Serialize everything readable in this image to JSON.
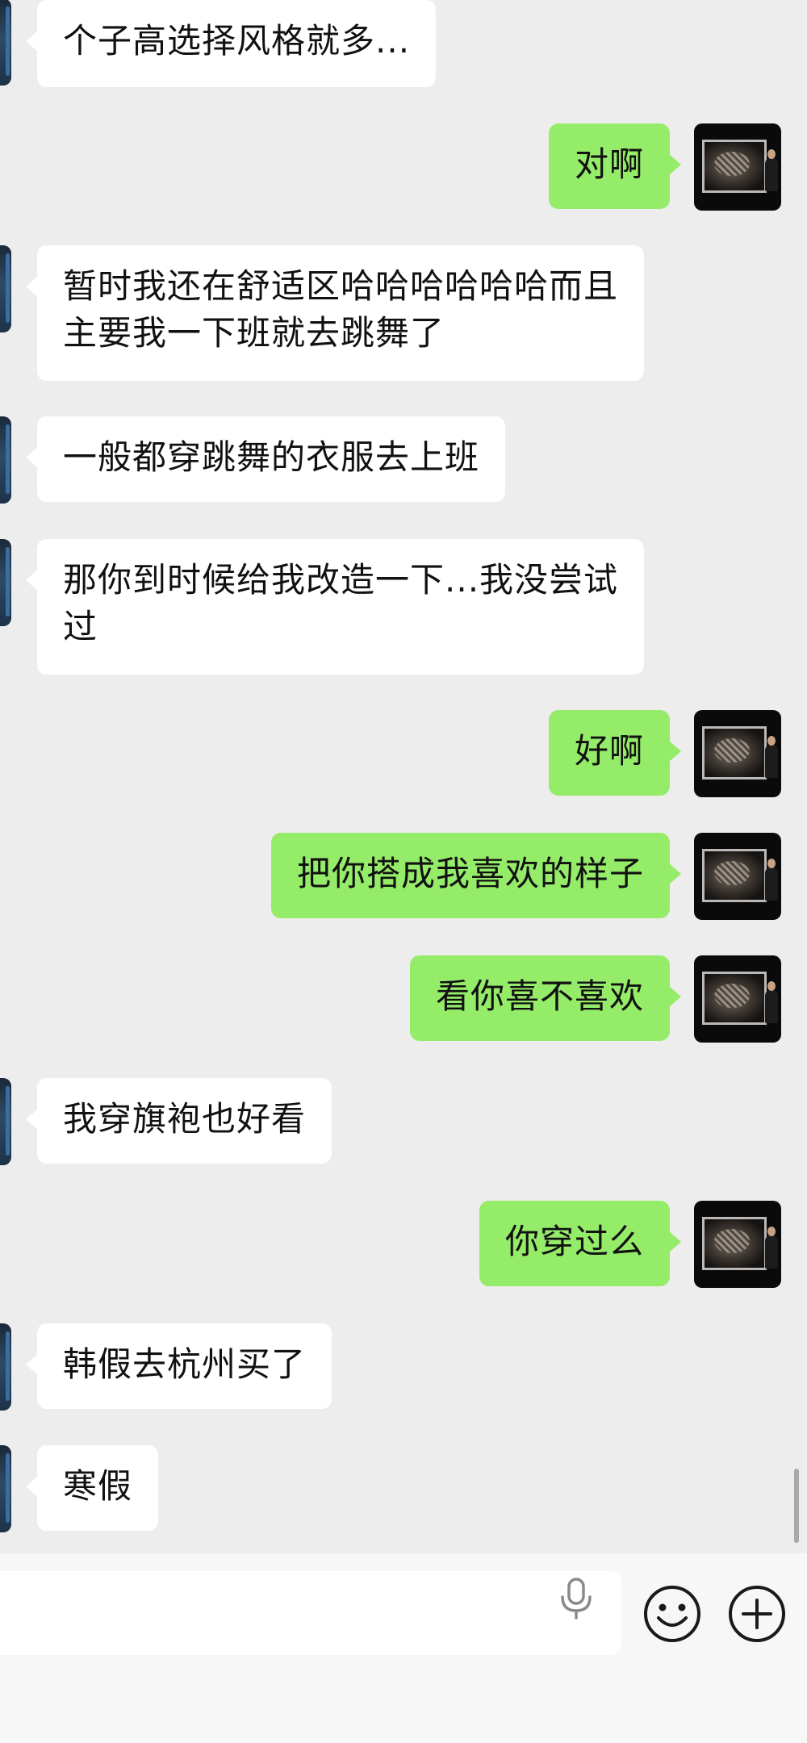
{
  "messages": [
    {
      "side": "in",
      "text": "个子高选择风格就多..."
    },
    {
      "side": "out",
      "text": "对啊"
    },
    {
      "side": "in",
      "text": "暂时我还在舒适区哈哈哈哈哈哈而且\n主要我一下班就去跳舞了"
    },
    {
      "side": "in",
      "text": "一般都穿跳舞的衣服去上班"
    },
    {
      "side": "in",
      "text": "那你到时候给我改造一下...我没尝试\n过"
    },
    {
      "side": "out",
      "text": "好啊"
    },
    {
      "side": "out",
      "text": "把你搭成我喜欢的样子"
    },
    {
      "side": "out",
      "text": "看你喜不喜欢"
    },
    {
      "side": "in",
      "text": "我穿旗袍也好看"
    },
    {
      "side": "out",
      "text": "你穿过么"
    },
    {
      "side": "in",
      "text": "韩假去杭州买了"
    },
    {
      "side": "in",
      "text": "寒假"
    }
  ],
  "input_bar": {
    "input_value": "",
    "icons": [
      "microphone-icon",
      "emoji-icon",
      "plus-icon"
    ]
  },
  "colors": {
    "background": "#ededed",
    "incoming_bubble": "#ffffff",
    "outgoing_bubble": "#95ec69",
    "text": "#111111",
    "input_bar": "#f7f7f7"
  }
}
